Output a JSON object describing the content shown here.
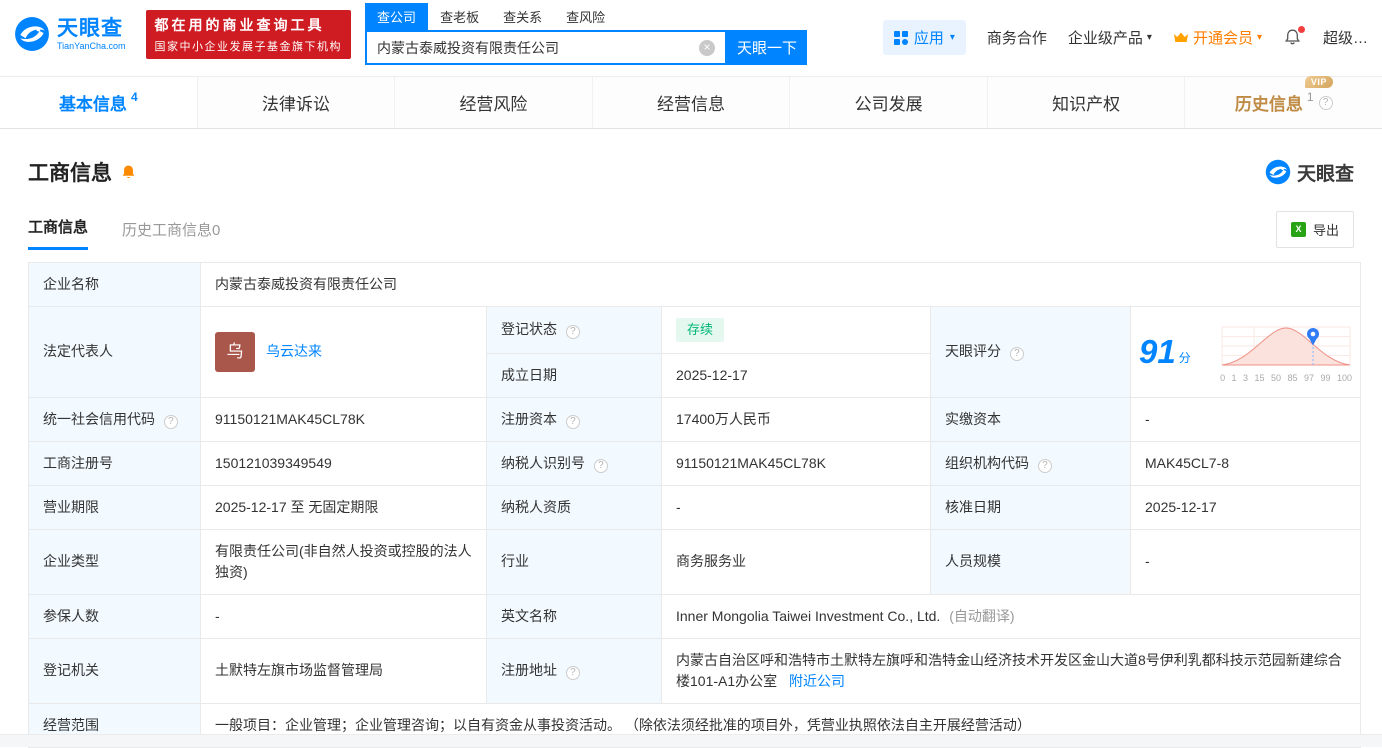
{
  "icons": {
    "caret": "▾",
    "clear": "×",
    "help": "?",
    "excel": "X"
  },
  "colors": {
    "brand_blue": "#0084ff",
    "promo_red": "#cf1b22",
    "vip_orange": "#ff7d00",
    "history_gold": "#bf8b45",
    "status_green": "#00b578",
    "avatar_brown": "#a9574b"
  },
  "header": {
    "brand": "天眼查",
    "brand_domain": "TianYanCha.com",
    "promo_line1": "都在用的商业查询工具",
    "promo_line2": "国家中小企业发展子基金旗下机构",
    "search_tabs": [
      {
        "label": "查公司",
        "active": true
      },
      {
        "label": "查老板",
        "active": false
      },
      {
        "label": "查关系",
        "active": false
      },
      {
        "label": "查风险",
        "active": false
      }
    ],
    "search_value": "内蒙古泰威投资有限责任公司",
    "search_button": "天眼一下",
    "apps_label": "应用",
    "menu_business": "商务合作",
    "menu_enterprise": "企业级产品",
    "menu_vip": "开通会员",
    "menu_super": "超级…"
  },
  "nav_tabs": [
    {
      "label": "基本信息",
      "count": "4"
    },
    {
      "label": "法律诉讼",
      "count": ""
    },
    {
      "label": "经营风险",
      "count": ""
    },
    {
      "label": "经营信息",
      "count": ""
    },
    {
      "label": "公司发展",
      "count": ""
    },
    {
      "label": "知识产权",
      "count": ""
    },
    {
      "label": "历史信息",
      "count": "1",
      "vip": "VIP"
    }
  ],
  "section": {
    "title": "工商信息",
    "watermark": "天眼查",
    "subtab_current": "工商信息",
    "subtab_history": "历史工商信息0",
    "export_label": "导出"
  },
  "fields": {
    "company_name_label": "企业名称",
    "company_name": "内蒙古泰威投资有限责任公司",
    "legal_rep_label": "法定代表人",
    "legal_rep_avatar": "乌",
    "legal_rep_name": "乌云达来",
    "reg_status_label": "登记状态",
    "reg_status_value": "存续",
    "establish_date_label": "成立日期",
    "establish_date": "2025-12-17",
    "score_label": "天眼评分",
    "score_value": "91",
    "score_unit": "分",
    "credit_code_label": "统一社会信用代码",
    "credit_code": "91150121MAK45CL78K",
    "reg_capital_label": "注册资本",
    "reg_capital": "17400万人民币",
    "paid_capital_label": "实缴资本",
    "paid_capital": "-",
    "reg_number_label": "工商注册号",
    "reg_number": "150121039349549",
    "taxpayer_id_label": "纳税人识别号",
    "taxpayer_id": "91150121MAK45CL78K",
    "org_code_label": "组织机构代码",
    "org_code": "MAK45CL7-8",
    "business_term_label": "营业期限",
    "business_term": "2025-12-17 至 无固定期限",
    "taxpayer_quality_label": "纳税人资质",
    "taxpayer_quality": "-",
    "approval_date_label": "核准日期",
    "approval_date": "2025-12-17",
    "company_type_label": "企业类型",
    "company_type": "有限责任公司(非自然人投资或控股的法人独资)",
    "industry_label": "行业",
    "industry": "商务服务业",
    "staff_size_label": "人员规模",
    "staff_size": "-",
    "insured_count_label": "参保人数",
    "insured_count": "-",
    "english_name_label": "英文名称",
    "english_name": "Inner Mongolia Taiwei Investment Co., Ltd.",
    "english_name_note": "(自动翻译)",
    "reg_authority_label": "登记机关",
    "reg_authority": "土默特左旗市场监督管理局",
    "reg_address_label": "注册地址",
    "reg_address": "内蒙古自治区呼和浩特市土默特左旗呼和浩特金山经济技术开发区金山大道8号伊利乳都科技示范园新建综合楼101-A1办公室",
    "nearby_link": "附近公司",
    "business_scope_label": "经营范围",
    "business_scope": "一般项目：企业管理；企业管理咨询；以自有资金从事投资活动。 （除依法须经批准的项目外，凭营业执照依法自主开展经营活动）"
  },
  "score_chart": {
    "score": 91,
    "axis_labels": [
      "0",
      "1",
      "3",
      "15",
      "50",
      "85",
      "97",
      "99",
      "100"
    ]
  }
}
